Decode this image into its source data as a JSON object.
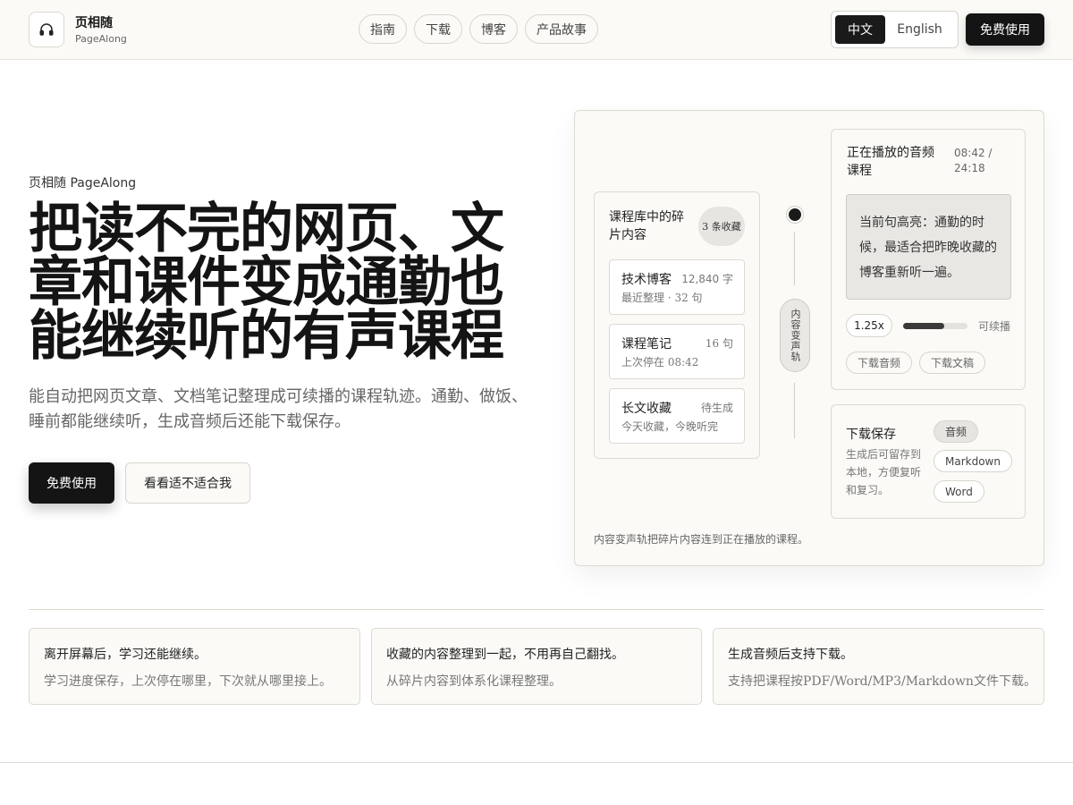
{
  "brand": {
    "name": "页相随",
    "sub": "PageAlong",
    "logo_icon": "headphones-icon"
  },
  "nav": {
    "items": [
      "指南",
      "下载",
      "博客",
      "产品故事"
    ]
  },
  "lang": {
    "zh": "中文",
    "en": "English",
    "active": "zh"
  },
  "header_cta": "免费使用",
  "hero": {
    "eyebrow": "页相随 PageAlong",
    "title": "把读不完的网页、文章和课件变成通勤也能继续听的有声课程",
    "desc": "能自动把网页文章、文档笔记整理成可续播的课程轨迹。通勤、做饭、睡前都能继续听，生成音频后还能下载保存。",
    "primary_cta": "免费使用",
    "secondary_cta": "看看适不适合我"
  },
  "library": {
    "title": "课程库中的碎片内容",
    "badge": "3 条收藏",
    "cards": [
      {
        "title": "技术博客",
        "meta": "12,840 字",
        "sub": "最近整理 · 32 句"
      },
      {
        "title": "课程笔记",
        "meta": "16 句",
        "sub": "上次停在 08:42"
      },
      {
        "title": "长文收藏",
        "meta": "待生成",
        "sub": "今天收藏，今晚听完"
      }
    ]
  },
  "track": {
    "label": "内容变声轨"
  },
  "player": {
    "title": "正在播放的音频课程",
    "time": "08:42 / 24:18",
    "highlight": "当前句高亮：通勤的时候，最适合把昨晚收藏的博客重新听一遍。",
    "speed": "1.25x",
    "progress": 0.64,
    "progress_label": "可续播",
    "chips": [
      "下载音频",
      "下载文稿"
    ]
  },
  "download": {
    "title": "下载保存",
    "desc": "生成后可留存到本地，方便复听和复习。",
    "formats": [
      "音频",
      "Markdown",
      "Word"
    ],
    "active_format": "音频"
  },
  "showcase_caption": "内容变声轨把碎片内容连到正在播放的课程。",
  "features": [
    {
      "title": "离开屏幕后，学习还能继续。",
      "desc": "学习进度保存，上次停在哪里，下次就从哪里接上。"
    },
    {
      "title": "收藏的内容整理到一起，不用再自己翻找。",
      "desc": "从碎片内容到体系化课程整理。"
    },
    {
      "title": "生成音频后支持下载。",
      "desc": "支持把课程按PDF/Word/MP3/Markdown文件下载。"
    }
  ],
  "colors": {
    "ink": "#141414",
    "paper": "#fbfaf7",
    "border": "#dedad2",
    "muted": "#777777"
  }
}
